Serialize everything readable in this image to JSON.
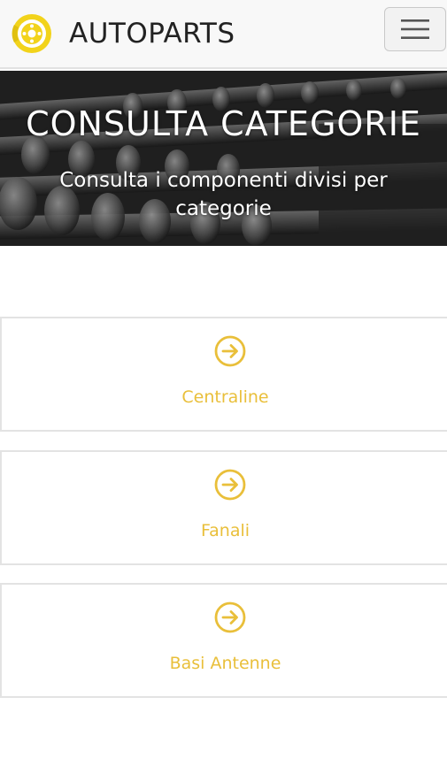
{
  "navbar": {
    "brand_name": "AUTOPARTS",
    "logo_icon": "brake-disc-logo-icon",
    "menu_icon": "hamburger-menu-icon",
    "brand_color": "#f2d31b"
  },
  "hero": {
    "title": "CONSULTA CATEGORIE",
    "subtitle": "Consulta i componenti divisi per categorie"
  },
  "categories": [
    {
      "label": "Centraline",
      "icon": "arrow-right-circle-icon"
    },
    {
      "label": "Fanali",
      "icon": "arrow-right-circle-icon"
    },
    {
      "label": "Basi Antenne",
      "icon": "arrow-right-circle-icon"
    }
  ],
  "accent_color": "#e9bf3a"
}
